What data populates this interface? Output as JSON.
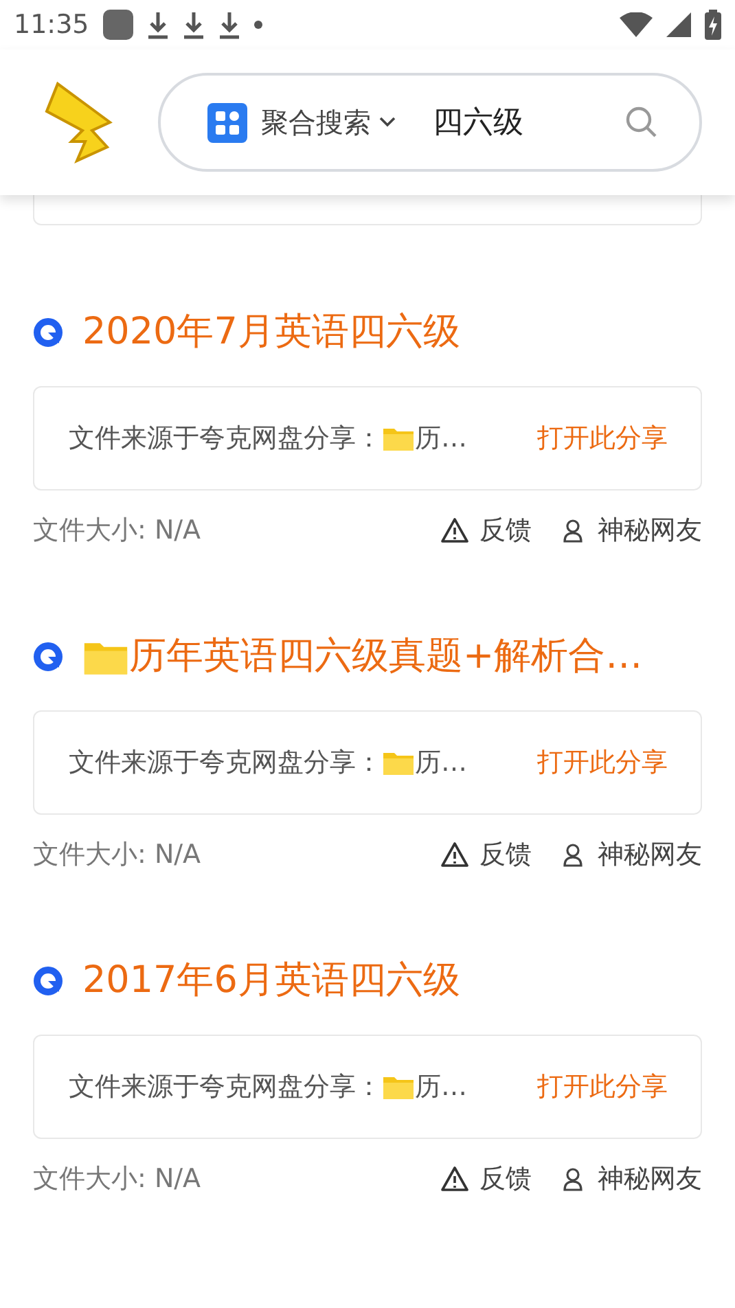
{
  "status_bar": {
    "time": "11:35"
  },
  "search": {
    "scope": "聚合搜索",
    "query": "四六级"
  },
  "results": [
    {
      "title": "2020年7月英语四六级",
      "folder_icon": false,
      "source": "文件来源于夸克网盘分享：",
      "file_name": "历…",
      "action": "打开此分享",
      "size": "文件大小: N/A",
      "feedback": "反馈",
      "uploader": "神秘网友"
    },
    {
      "title": "历年英语四六级真题+解析合…",
      "folder_icon": true,
      "source": "文件来源于夸克网盘分享：",
      "file_name": "历…",
      "action": "打开此分享",
      "size": "文件大小: N/A",
      "feedback": "反馈",
      "uploader": "神秘网友"
    },
    {
      "title": "2017年6月英语四六级",
      "folder_icon": false,
      "source": "文件来源于夸克网盘分享：",
      "file_name": "历…",
      "action": "打开此分享",
      "size": "文件大小: N/A",
      "feedback": "反馈",
      "uploader": "神秘网友"
    }
  ]
}
